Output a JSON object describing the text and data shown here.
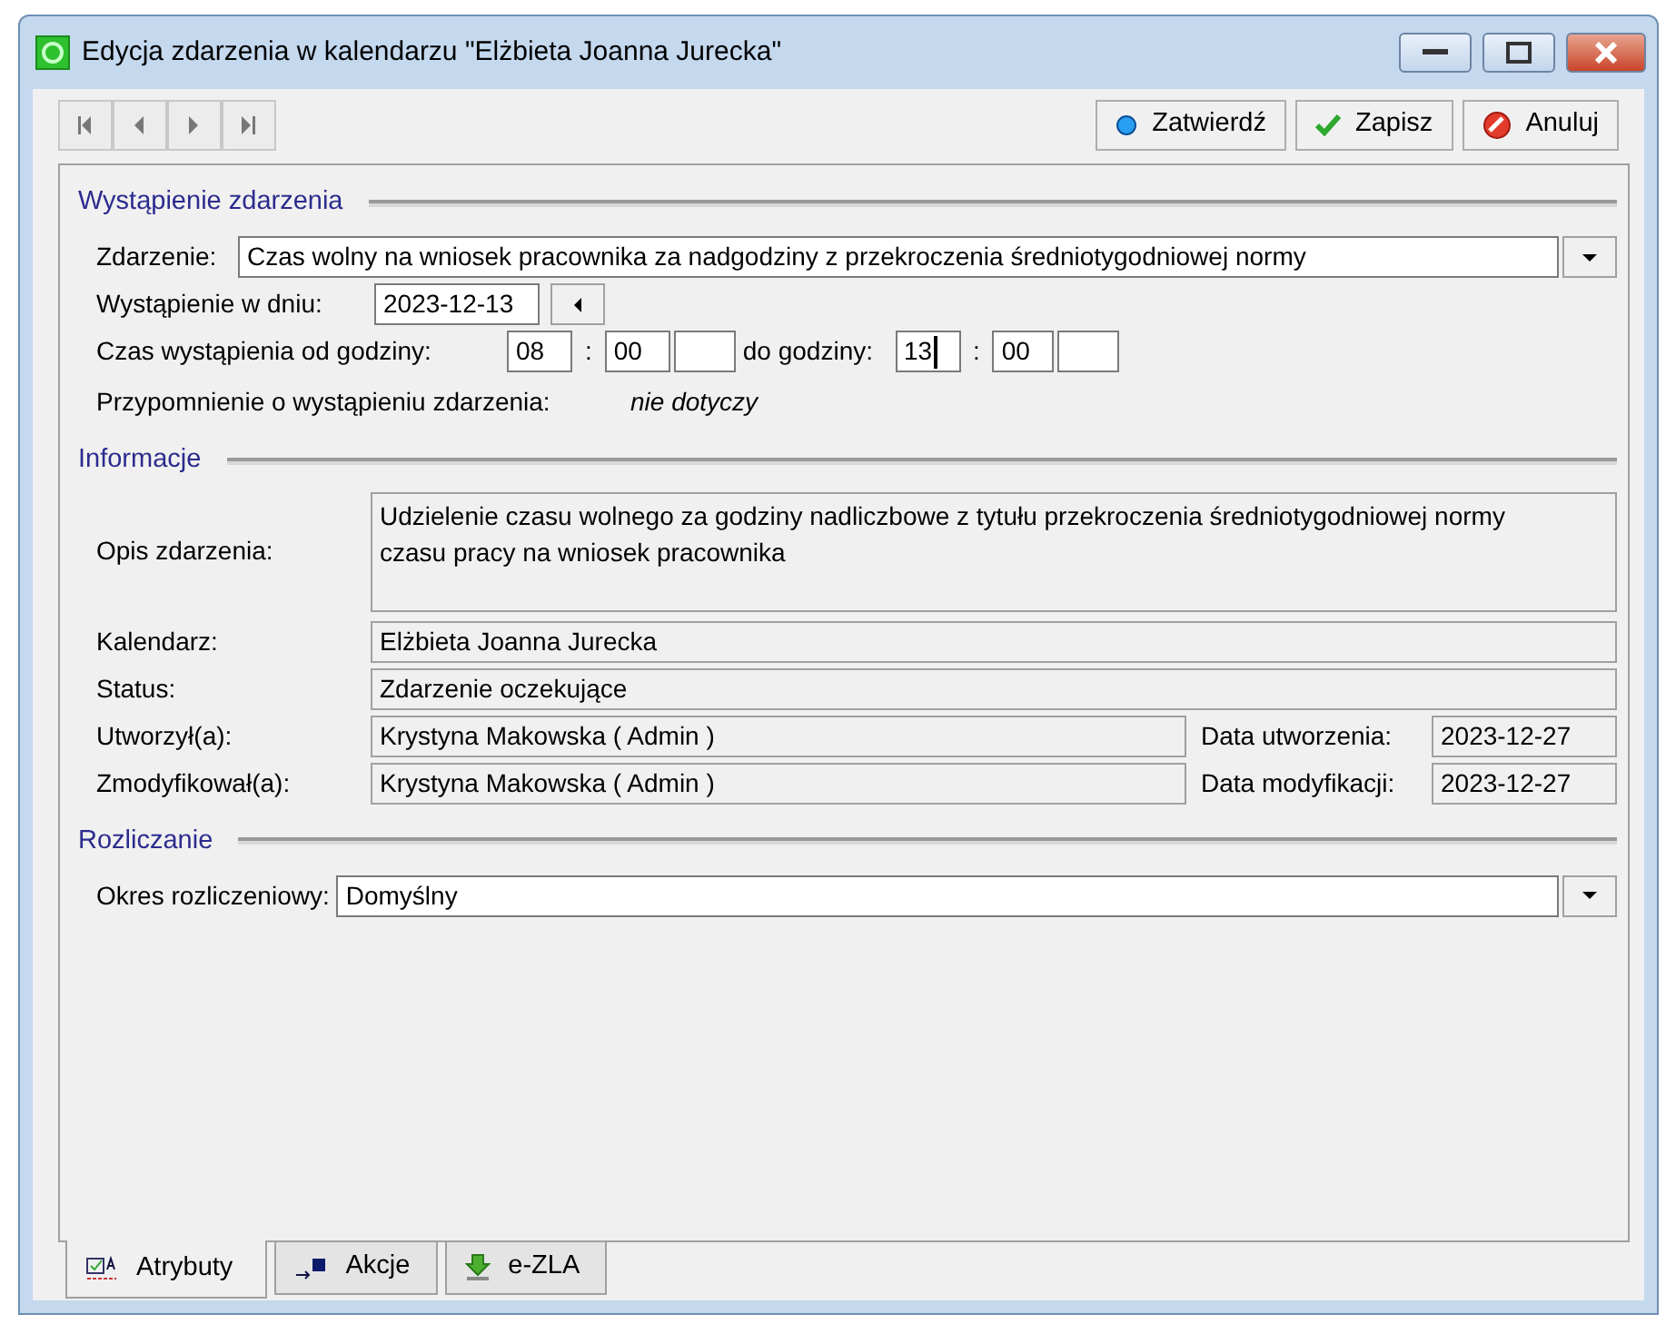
{
  "window": {
    "title": "Edycja zdarzenia w kalendarzu \"Elżbieta Joanna Jurecka\""
  },
  "actions": [
    {
      "label": "Zatwierdź",
      "kind": "confirm"
    },
    {
      "label": "Zapisz",
      "kind": "save"
    },
    {
      "label": "Anuluj",
      "kind": "cancel"
    }
  ],
  "occurrence": {
    "heading": "Wystąpienie zdarzenia",
    "event": {
      "label": "Zdarzenie:",
      "value": "Czas wolny na wniosek pracownika za nadgodziny z przekroczenia średniotygodniowej normy"
    },
    "date": {
      "label": "Wystąpienie w dniu:",
      "value": "2023-12-13"
    },
    "time": {
      "label_from": "Czas wystąpienia od godziny:",
      "label_to": "do godziny:",
      "separator_from": ":",
      "separator_to": ":",
      "from": [
        {
          "value": "08",
          "focused": false
        },
        {
          "value": "00",
          "focused": false
        },
        {
          "focused": false
        }
      ],
      "to": [
        {
          "value": "13",
          "focused": true
        },
        {
          "value": "00",
          "focused": false
        },
        {
          "focused": false
        }
      ]
    },
    "reminder": {
      "label": "Przypomnienie o wystąpieniu zdarzenia:",
      "value": "nie dotyczy"
    }
  },
  "information": {
    "heading": "Informacje",
    "description": {
      "label": "Opis zdarzenia:",
      "value": "Udzielenie czasu wolnego za godziny nadliczbowe z tytułu przekroczenia średniotygodniowej normy czasu pracy na wniosek pracownika"
    },
    "rows": [
      {
        "label": "Kalendarz:",
        "value": "Elżbieta Joanna Jurecka"
      },
      {
        "label": "Status:",
        "value": "Zdarzenie oczekujące"
      },
      {
        "label": "Utworzył(a):",
        "value": "Krystyna Makowska ( Admin )",
        "date_label": "Data utworzenia:",
        "date_value": "2023-12-27"
      },
      {
        "label": "Zmodyfikował(a):",
        "value": "Krystyna Makowska ( Admin )",
        "date_label": "Data modyfikacji:",
        "date_value": "2023-12-27"
      }
    ]
  },
  "billing": {
    "heading": "Rozliczanie",
    "period": {
      "label": "Okres rozliczeniowy:",
      "value": "Domyślny"
    }
  },
  "tabs": [
    {
      "label": "Atrybuty",
      "kind": "attributes",
      "selected": true
    },
    {
      "label": "Akcje",
      "kind": "actions",
      "selected": false
    },
    {
      "label": "e-ZLA",
      "kind": "ezla",
      "selected": false
    }
  ]
}
